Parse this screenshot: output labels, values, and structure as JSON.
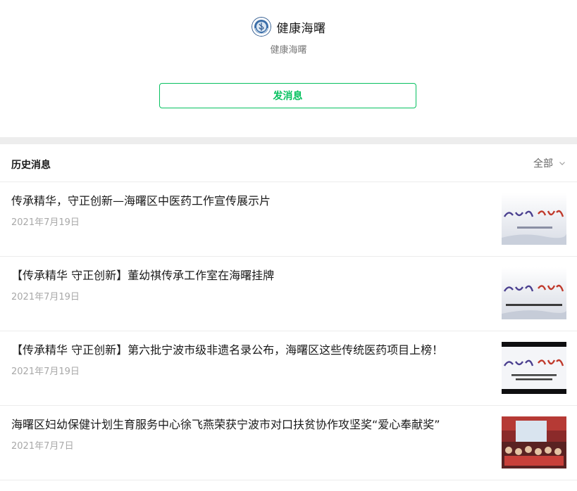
{
  "profile": {
    "name": "健康海曙",
    "subtitle": "健康海曙",
    "send_button": "发消息"
  },
  "history": {
    "title": "历史消息",
    "filter_label": "全部"
  },
  "articles": [
    {
      "title": "传承精华，守正创新—海曙区中医药工作宣传展示片",
      "date": "2021年7月19日",
      "thumb": "banner-heritage-1"
    },
    {
      "title": "【传承精华 守正创新】董幼祺传承工作室在海曙挂牌",
      "date": "2021年7月19日",
      "thumb": "banner-heritage-2"
    },
    {
      "title": "【传承精华 守正创新】第六批宁波市级非遗名录公布，海曙区这些传统医药项目上榜！",
      "date": "2021年7月19日",
      "thumb": "banner-heritage-3"
    },
    {
      "title": "海曙区妇幼保健计划生育服务中心徐飞燕荣获宁波市对口扶贫协作攻坚奖“爱心奉献奖”",
      "date": "2021年7月7日",
      "thumb": "award-ceremony-photo"
    }
  ],
  "colors": {
    "accent": "#07c160",
    "band": "#ededed",
    "banner_text": "#4a3f8f",
    "banner_accent": "#c0392b"
  }
}
